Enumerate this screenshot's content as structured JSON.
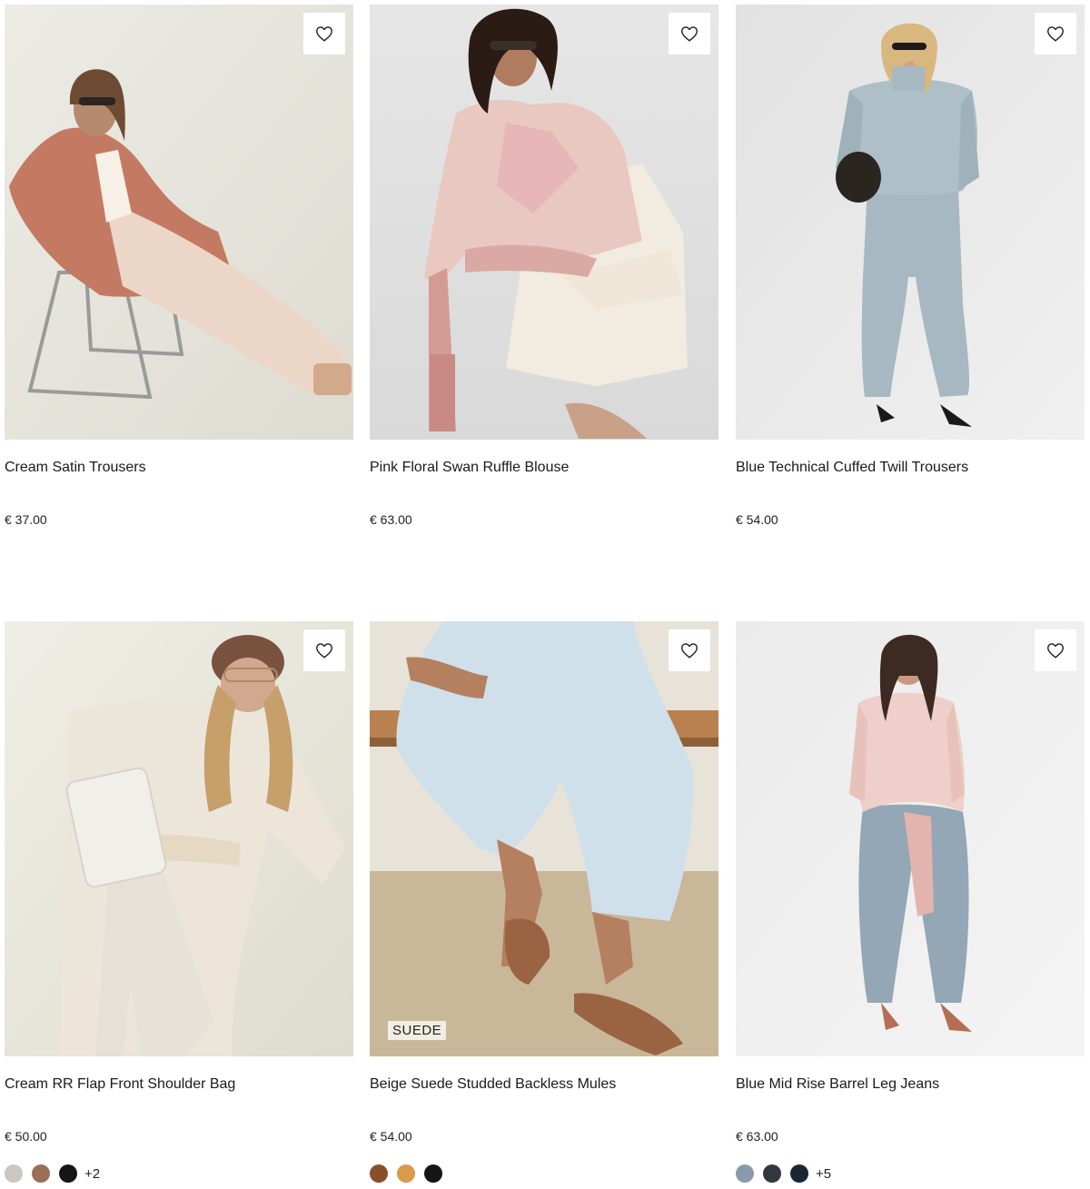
{
  "products": [
    {
      "name": "Cream Satin Trousers",
      "price": "€ 37.00"
    },
    {
      "name": "Pink Floral Swan Ruffle Blouse",
      "price": "€ 63.00"
    },
    {
      "name": "Blue Technical Cuffed Twill Trousers",
      "price": "€ 54.00"
    },
    {
      "name": "Cream RR Flap Front Shoulder Bag",
      "price": "€ 50.00",
      "swatches": [
        "#c9c7c0",
        "#9c6e55",
        "#151515"
      ],
      "more_colours": "+2"
    },
    {
      "name": "Beige Suede Studded Backless Mules",
      "price": "€ 54.00",
      "badge": "SUEDE",
      "swatches": [
        "#8a4f2a",
        "#d99a4a",
        "#151515"
      ]
    },
    {
      "name": "Blue Mid Rise Barrel Leg Jeans",
      "price": "€ 63.00",
      "swatches": [
        "#8b9aab",
        "#33373d",
        "#1b2633"
      ],
      "more_colours": "+5"
    }
  ],
  "colors": {
    "text": "#1a1a1a",
    "favourite_button_bg": "#ffffff"
  },
  "icons": {
    "favourite": "heart-outline-icon"
  }
}
